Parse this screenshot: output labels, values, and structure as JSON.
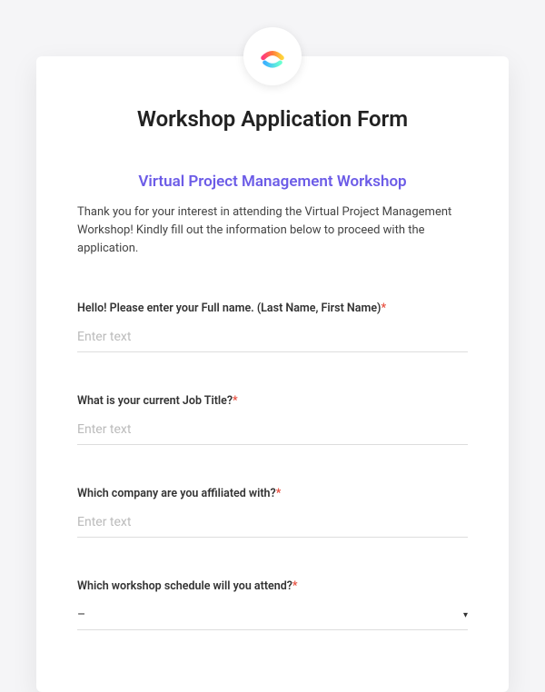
{
  "page_title": "Workshop Application Form",
  "subtitle": "Virtual Project Management Workshop",
  "intro_text": "Thank you for your interest in attending the Virtual Project Management Workshop! Kindly fill out the information below to proceed with the application.",
  "required_marker": "*",
  "fields": {
    "fullname": {
      "label": "Hello! Please enter your Full name. (Last Name, First Name)",
      "placeholder": "Enter text"
    },
    "jobtitle": {
      "label": "What is your current Job Title?",
      "placeholder": "Enter text"
    },
    "company": {
      "label": "Which company are you affiliated with?",
      "placeholder": "Enter text"
    },
    "schedule": {
      "label": "Which workshop schedule will you attend?",
      "selected": "–"
    }
  }
}
